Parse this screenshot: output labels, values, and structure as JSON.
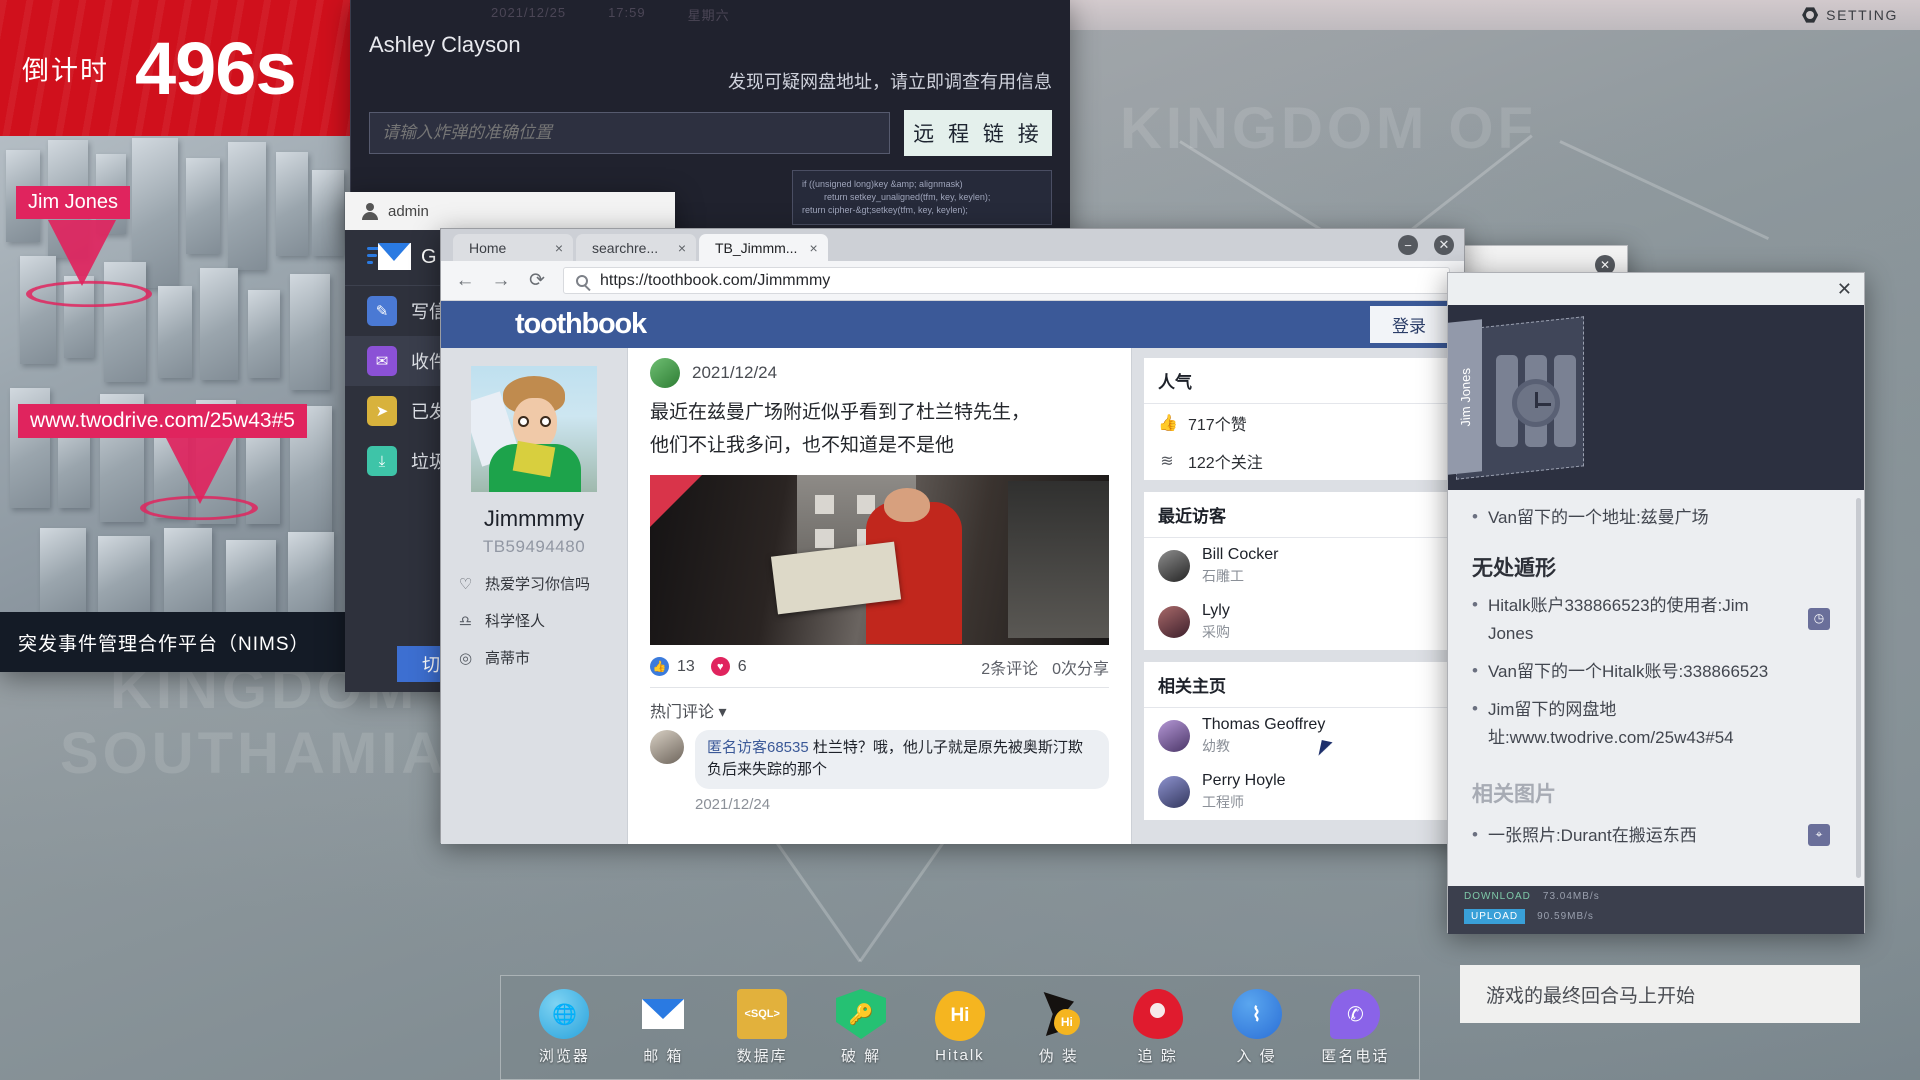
{
  "system_bar": {
    "setting_label": "SETTING",
    "gear_icon": "gear-icon"
  },
  "countdown": {
    "label": "倒计时",
    "value": "496s"
  },
  "nims": {
    "title": "突发事件管理合作平台（NIMS）",
    "markers": [
      {
        "label": "Jim Jones"
      },
      {
        "label": "www.twodrive.com/25w43#5"
      }
    ]
  },
  "message_window": {
    "date": "2021/12/25",
    "time": "17:59",
    "weekday": "星期六",
    "sender": "Ashley Clayson",
    "body": "发现可疑网盘地址，请立即调查有用信息",
    "input_placeholder": "请输入炸弹的准确位置",
    "link_button": "远 程 链 接",
    "code_lines": [
      "if ((unsigned long)key &amp; alignmask)",
      "return setkey_unaligned(tfm, key, keylen);",
      "return cipher-&gt;setkey(tfm, key, keylen);"
    ]
  },
  "mail": {
    "account": "admin",
    "brand": "G",
    "nav": [
      {
        "label": "写信",
        "icon": "compose-icon",
        "color": "#4a79d4"
      },
      {
        "label": "收件箱",
        "icon": "inbox-icon",
        "color": "#8b51d6"
      },
      {
        "label": "已发送",
        "icon": "sent-icon",
        "color": "#d8b23c"
      },
      {
        "label": "垃圾箱",
        "icon": "trash-icon",
        "color": "#3ec4a8"
      }
    ],
    "switch_button": "切换"
  },
  "browser": {
    "tabs": [
      {
        "label": "Home",
        "close": "×"
      },
      {
        "label": "searchre...",
        "close": "×"
      },
      {
        "label": "TB_Jimmm...",
        "close": "×"
      }
    ],
    "window_controls": {
      "minimize": "−",
      "close": "✕"
    },
    "nav": {
      "back": "←",
      "forward": "→",
      "reload": "⟳",
      "search_icon": "search-icon"
    },
    "url": "https://toothbook.com/Jimmmmy"
  },
  "toothbook": {
    "brand": "toothbook",
    "login_button": "登录",
    "profile": {
      "name": "Jimmmmy",
      "id": "TB59494480",
      "details": [
        {
          "icon": "heart-icon",
          "glyph": "♡",
          "text": "热爱学习你信吗"
        },
        {
          "icon": "tie-icon",
          "glyph": "♎",
          "text": "科学怪人"
        },
        {
          "icon": "location-icon",
          "glyph": "◎",
          "text": "高蒂市"
        }
      ]
    },
    "post": {
      "date": "2021/12/24",
      "text_line1": "最近在兹曼广场附近似乎看到了杜兰特先生，",
      "text_line2": "他们不让我多问，也不知道是不是他",
      "image_badge": "★",
      "likes": "13",
      "hearts": "6",
      "comments_count": "2条评论",
      "shares_count": "0次分享"
    },
    "comments": {
      "header": "热门评论",
      "items": [
        {
          "author": "匿名访客68535",
          "text": "杜兰特？哦，他儿子就是原先被奥斯汀欺负后来失踪的那个",
          "date": "2021/12/24"
        }
      ]
    },
    "sidebar": {
      "popularity": {
        "title": "人气",
        "rows": [
          {
            "icon": "thumb-up-icon",
            "glyph": "👍",
            "text": "717个赞"
          },
          {
            "icon": "rss-icon",
            "glyph": "((",
            "text": "122个关注"
          }
        ]
      },
      "recent_visitors": {
        "title": "最近访客",
        "people": [
          {
            "name": "Bill Cocker",
            "job": "石雕工",
            "color": "#3b3b3b"
          },
          {
            "name": "Lyly",
            "job": "采购",
            "color": "#6b3c4e"
          }
        ]
      },
      "related_pages": {
        "title": "相关主页",
        "people": [
          {
            "name": "Thomas Geoffrey",
            "job": "幼教",
            "color": "#7f6aa8"
          },
          {
            "name": "Perry Hoyle",
            "job": "工程师",
            "color": "#5a5f92"
          }
        ]
      }
    }
  },
  "notes": {
    "close": "✕",
    "hero_tab_label": "Jim Jones",
    "hero_icon": "bomb-timer-icon",
    "sections": [
      {
        "title": "",
        "faded": false,
        "items": [
          {
            "text": "Van留下的一个地址:兹曼广场",
            "pin": null,
            "faded": false
          }
        ]
      },
      {
        "title": "无处遁形",
        "faded": false,
        "items": [
          {
            "text": "Hitalk账户338866523的使用者:Jim Jones",
            "pin": "clock-pin-icon",
            "faded": false
          },
          {
            "text": "Van留下的一个Hitalk账号:338866523",
            "pin": null,
            "faded": false
          },
          {
            "text": "Jim留下的网盘地址:www.twodrive.com/25w43#54",
            "pin": null,
            "faded": false
          }
        ]
      },
      {
        "title": "相关图片",
        "faded": true,
        "items": [
          {
            "text": "一张照片:Durant在搬运东西",
            "pin": "location-pin-icon",
            "faded": false
          }
        ]
      }
    ],
    "speeds": {
      "download_label": "DOWNLOAD",
      "download_value": "73.04MB/s",
      "upload_label": "UPLOAD",
      "upload_value": "90.59MB/s"
    },
    "footer_text": "游戏的最终回合马上开始"
  },
  "dock": {
    "items": [
      {
        "label": "浏览器",
        "icon": "browser-icon"
      },
      {
        "label": "邮 箱",
        "icon": "mail-icon"
      },
      {
        "label": "数据库",
        "icon": "database-icon",
        "glyph": "<SQL>"
      },
      {
        "label": "破 解",
        "icon": "crack-icon"
      },
      {
        "label": "Hitalk",
        "icon": "hitalk-icon",
        "glyph": "Hi"
      },
      {
        "label": "伪 装",
        "icon": "disguise-icon",
        "glyph": "Hi"
      },
      {
        "label": "追 踪",
        "icon": "track-icon"
      },
      {
        "label": "入 侵",
        "icon": "invade-icon"
      },
      {
        "label": "匿名电话",
        "icon": "anon-phone-icon",
        "glyph": "✆"
      }
    ]
  },
  "background": {
    "words": [
      "KINGDOM OF",
      "KINGDOM",
      "SOUTHAMIA"
    ]
  },
  "colors": {
    "alert_red": "#d0101c",
    "marker_pink": "#e0245e",
    "fb_blue": "#3b5998",
    "dark_panel": "#20222e"
  }
}
